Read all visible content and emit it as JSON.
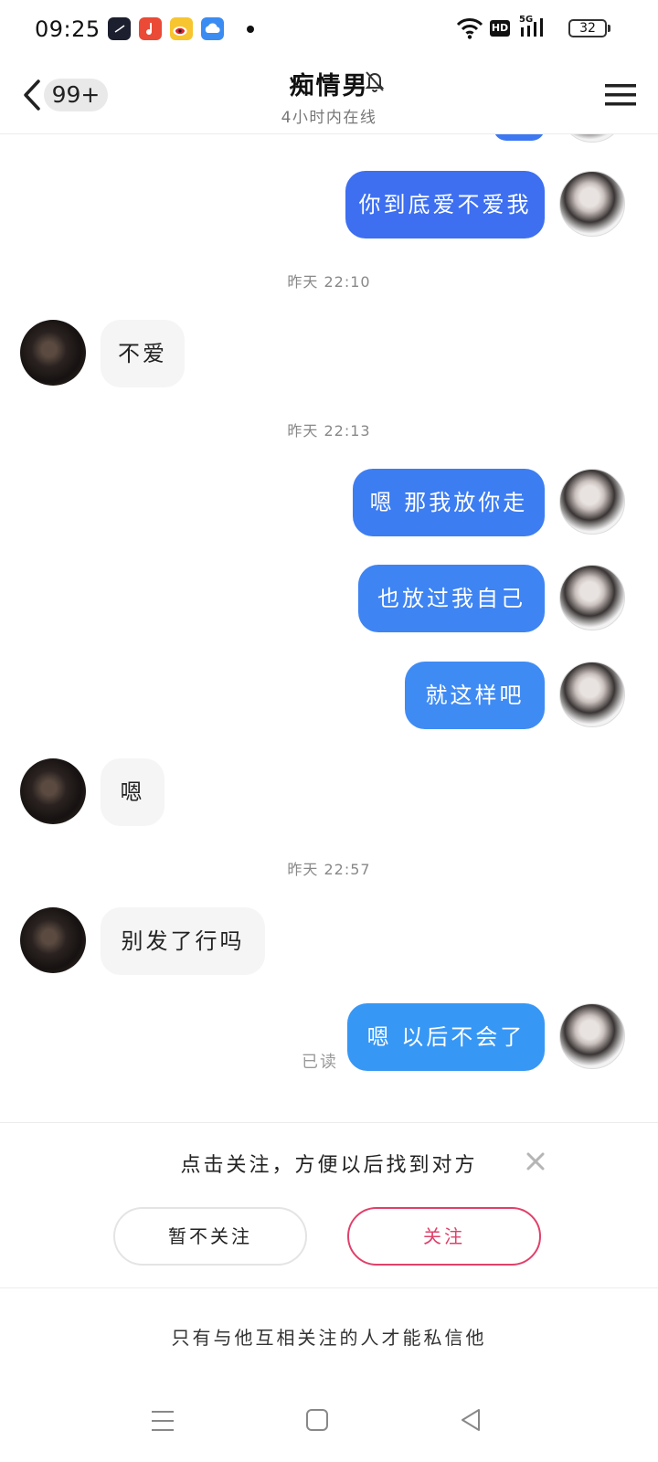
{
  "status_bar": {
    "time": "09:25",
    "battery": "32",
    "network": "5G",
    "hd_label": "HD",
    "notification_icons": [
      "clock-app-icon",
      "music-app-icon",
      "weibo-app-icon",
      "cloud-app-icon"
    ]
  },
  "header": {
    "unread_badge": "99+",
    "contact_name": "痴情男",
    "online_status": "4小时内在线"
  },
  "messages": [
    {
      "type": "outgoing",
      "text": "你到底爱不爱我"
    },
    {
      "type": "timestamp",
      "text": "昨天 22:10"
    },
    {
      "type": "incoming",
      "text": "不爱"
    },
    {
      "type": "timestamp",
      "text": "昨天 22:13"
    },
    {
      "type": "outgoing",
      "text": "嗯 那我放你走"
    },
    {
      "type": "outgoing",
      "text": "也放过我自己"
    },
    {
      "type": "outgoing",
      "text": "就这样吧"
    },
    {
      "type": "incoming",
      "text": "嗯"
    },
    {
      "type": "timestamp",
      "text": "昨天 22:57"
    },
    {
      "type": "incoming",
      "text": "别发了行吗"
    },
    {
      "type": "outgoing",
      "text": "嗯 以后不会了",
      "read_receipt": "已读"
    }
  ],
  "follow_prompt": {
    "tip": "点击关注，方便以后找到对方",
    "decline_label": "暂不关注",
    "follow_label": "关注"
  },
  "notice": "只有与他互相关注的人才能私信他",
  "colors": {
    "bubble_blue": "#3d78f2",
    "follow_pink": "#e0406a",
    "incoming_bubble": "#f5f5f5"
  }
}
